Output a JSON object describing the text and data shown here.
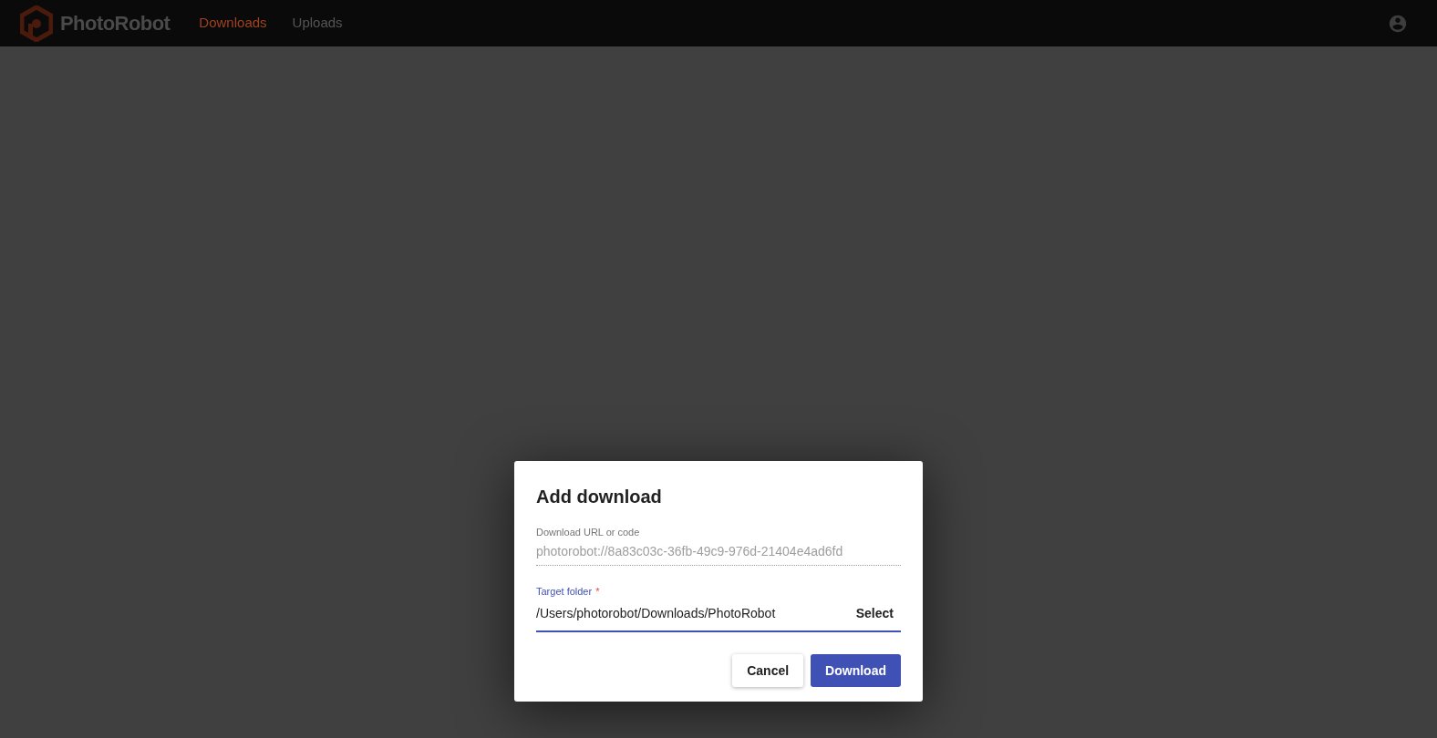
{
  "app_bar": {
    "brand": "PhotoRobot",
    "nav": [
      {
        "label": "Downloads",
        "selected": true
      },
      {
        "label": "Uploads",
        "selected": false
      }
    ]
  },
  "dialog": {
    "title": "Add download",
    "fields": [
      {
        "label": "Download URL or code",
        "value": "photorobot://8a83c03c-36fb-49c9-976d-21404e4ad6fd",
        "disabled": true,
        "focused": false
      },
      {
        "label": "Target folder",
        "value": "/Users/photorobot/Downloads/PhotoRobot",
        "disabled": false,
        "focused": true,
        "required_mark": "*",
        "action": "Select"
      }
    ],
    "buttons": [
      {
        "label": "Cancel",
        "kind": "secondary"
      },
      {
        "label": "Download",
        "kind": "primary"
      }
    ]
  }
}
